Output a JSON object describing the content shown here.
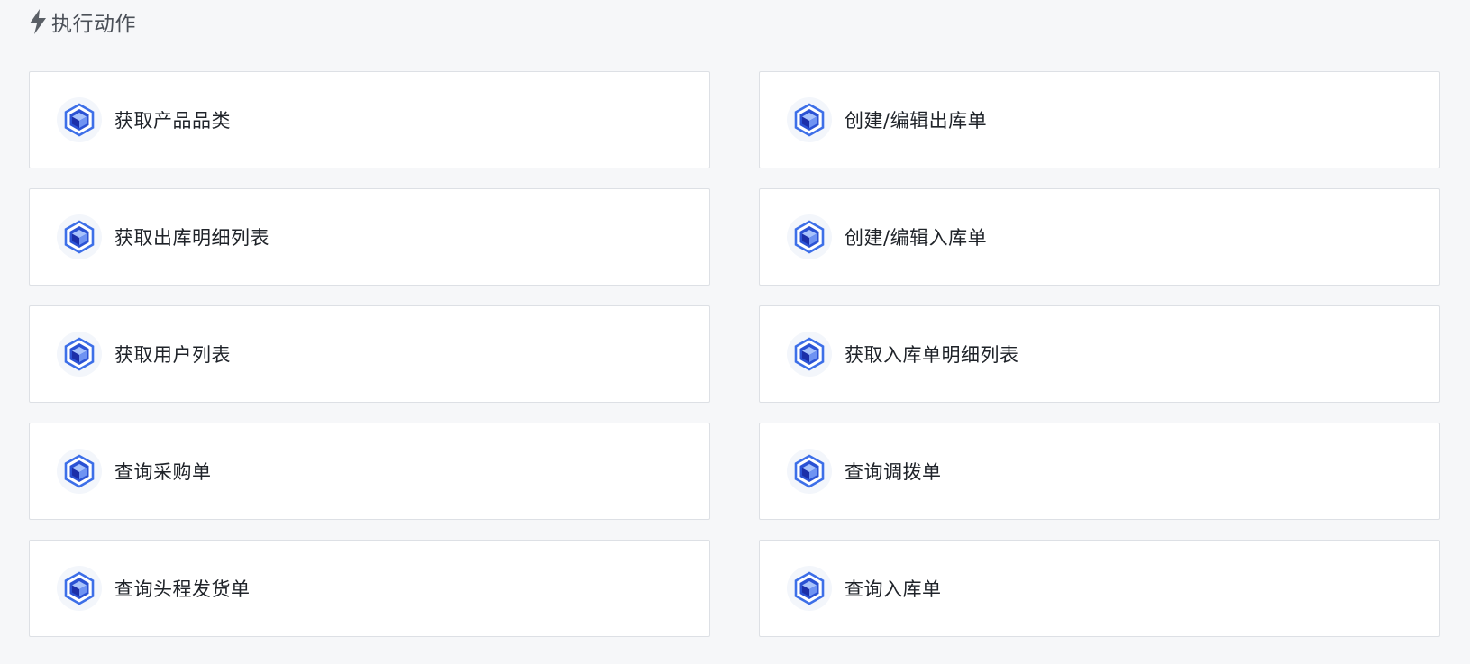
{
  "section": {
    "title": "执行动作",
    "icon": "lightning-bolt-icon"
  },
  "actions": {
    "left": [
      {
        "label": "获取产品品类",
        "icon": "cube-hexagon-icon"
      },
      {
        "label": "获取出库明细列表",
        "icon": "cube-hexagon-icon"
      },
      {
        "label": "获取用户列表",
        "icon": "cube-hexagon-icon"
      },
      {
        "label": "查询采购单",
        "icon": "cube-hexagon-icon"
      },
      {
        "label": "查询头程发货单",
        "icon": "cube-hexagon-icon"
      }
    ],
    "right": [
      {
        "label": "创建/编辑出库单",
        "icon": "cube-hexagon-icon"
      },
      {
        "label": "创建/编辑入库单",
        "icon": "cube-hexagon-icon"
      },
      {
        "label": "获取入库单明细列表",
        "icon": "cube-hexagon-icon"
      },
      {
        "label": "查询调拨单",
        "icon": "cube-hexagon-icon"
      },
      {
        "label": "查询入库单",
        "icon": "cube-hexagon-icon"
      }
    ]
  },
  "colors": {
    "accent": "#2f64e6",
    "accent_light": "#8fb0f7",
    "icon_dark": "#1c2fa8",
    "background": "#f6f7f9",
    "card_border": "#dde0e5"
  }
}
